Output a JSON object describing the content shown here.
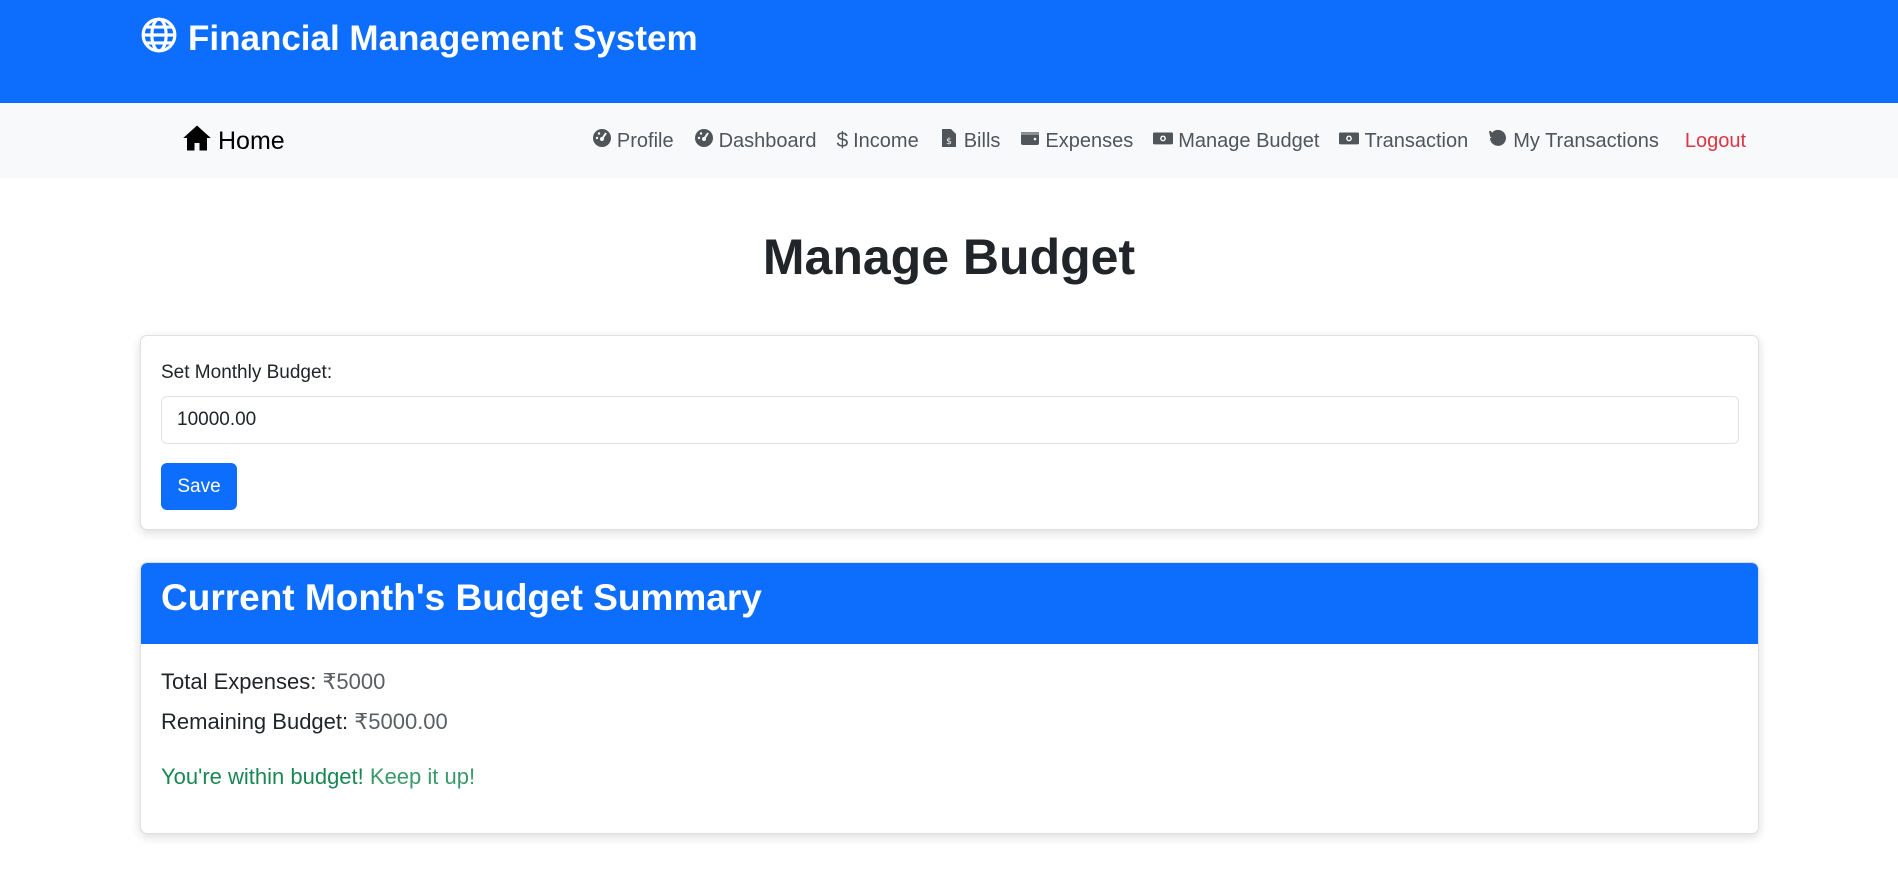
{
  "header": {
    "brand_title": "Financial Management System",
    "brand_icon": "globe-icon",
    "background_color": "#0d6efd"
  },
  "navbar": {
    "home_label": "Home",
    "home_icon": "house-icon",
    "items": [
      {
        "label": "Profile",
        "icon": "gauge-icon"
      },
      {
        "label": "Dashboard",
        "icon": "gauge-icon"
      },
      {
        "label": "Income",
        "icon": "dollar-icon"
      },
      {
        "label": "Bills",
        "icon": "bill-file-icon"
      },
      {
        "label": "Expenses",
        "icon": "wallet-icon"
      },
      {
        "label": "Manage Budget",
        "icon": "money-bill-icon"
      },
      {
        "label": "Transaction",
        "icon": "money-bill-icon"
      },
      {
        "label": "My Transactions",
        "icon": "history-icon"
      }
    ],
    "logout_label": "Logout",
    "logout_color": "#dc3545"
  },
  "page": {
    "title": "Manage Budget"
  },
  "budget_form": {
    "label": "Set Monthly Budget:",
    "value": "10000.00",
    "save_label": "Save"
  },
  "summary": {
    "title": "Current Month's Budget Summary",
    "total_expenses_label": "Total Expenses:",
    "total_expenses_value": "₹5000",
    "remaining_label": "Remaining Budget:",
    "remaining_value": "₹5000.00",
    "status_strong": "You're within budget!",
    "status_rest": "Keep it up!",
    "status_color": "#198754"
  }
}
